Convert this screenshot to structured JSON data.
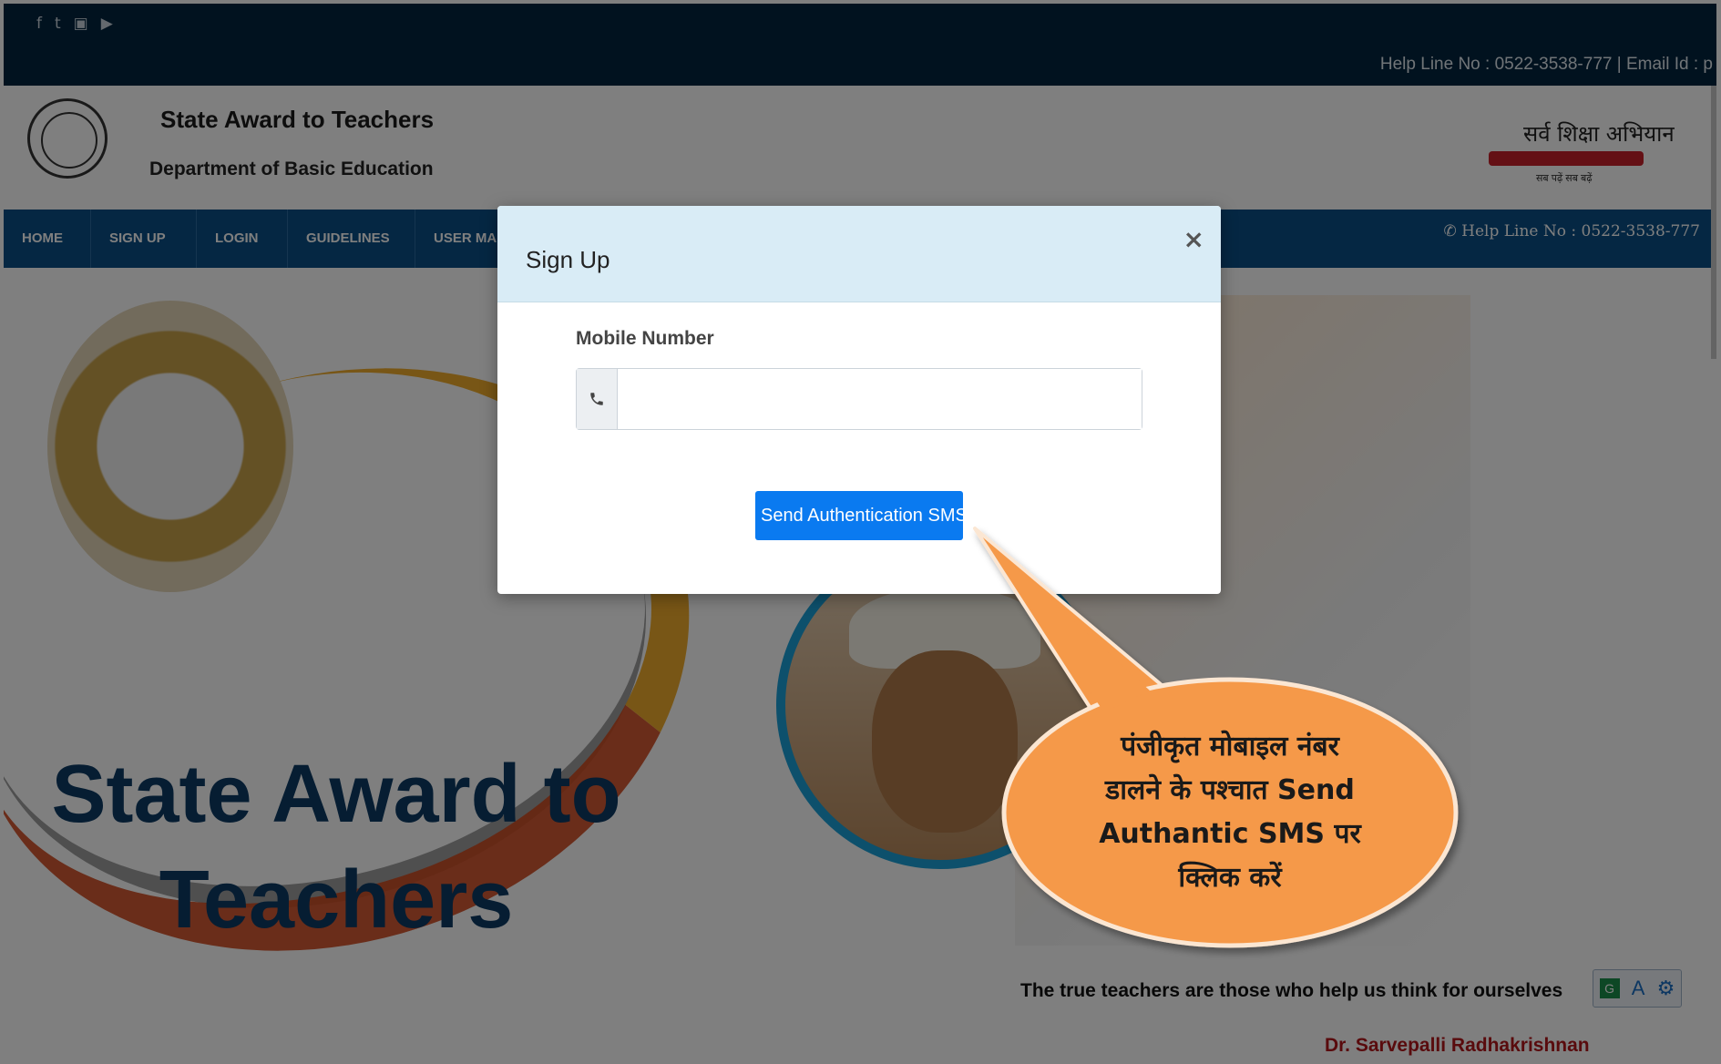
{
  "social_icons": [
    "facebook-icon",
    "twitter-icon",
    "youtube-icon",
    "play-icon"
  ],
  "topbar": {
    "helpline": "Help Line No : 0522-3538-777 | Email Id : p"
  },
  "header": {
    "title": "State Award to Teachers",
    "subtitle": "Department of Basic Education",
    "ssa_logo_text": "सर्व शिक्षा अभियान",
    "ssa_logo_tagline": "सब पढ़ें सब बढ़ें"
  },
  "nav": {
    "items": [
      "HOME",
      "SIGN UP",
      "LOGIN",
      "GUIDELINES",
      "USER MAN"
    ],
    "helpline": "Help Line No : 0522-3538-777"
  },
  "hero": {
    "big_title_line1": "State Award to",
    "big_title_line2": "Teachers",
    "quote": "The true teachers are those who help us think for ourselves",
    "quote_author": "Dr. Sarvepalli Radhakrishnan"
  },
  "modal": {
    "title": "Sign Up",
    "close_label": "×",
    "field_label": "Mobile Number",
    "mobile_value": "",
    "button_label": "Send Authentication SMS"
  },
  "callout": {
    "line1": "पंजीकृत मोबाइल नंबर",
    "line2": "डालने के पश्चात Send",
    "line3": "Authantic SMS पर",
    "line4": "क्लिक करें"
  },
  "colors": {
    "topbar": "#02253f",
    "nav": "#0b4f86",
    "modal_header": "#d9ecf6",
    "button": "#0a7af0",
    "callout_fill": "#f5994a",
    "quote_author": "#b3161b"
  }
}
